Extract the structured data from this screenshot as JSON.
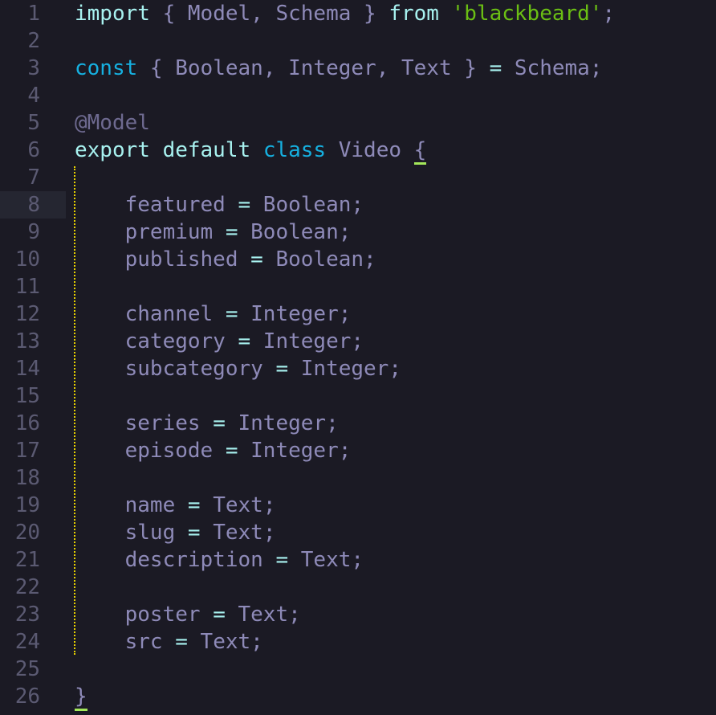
{
  "editor": {
    "active_line": 8,
    "lines": [
      {
        "n": "1",
        "tokens": [
          [
            "kw",
            "import"
          ],
          [
            "p",
            " { Model, Schema } "
          ],
          [
            "kw",
            "from"
          ],
          [
            "p",
            " "
          ],
          [
            "str",
            "'blackbeard'"
          ],
          [
            "p",
            ";"
          ]
        ]
      },
      {
        "n": "2",
        "tokens": []
      },
      {
        "n": "3",
        "tokens": [
          [
            "kw2",
            "const"
          ],
          [
            "p",
            " { Boolean, Integer, Text } "
          ],
          [
            "op",
            "="
          ],
          [
            "p",
            " Schema;"
          ]
        ]
      },
      {
        "n": "4",
        "tokens": []
      },
      {
        "n": "5",
        "tokens": [
          [
            "dec",
            "@Model"
          ]
        ]
      },
      {
        "n": "6",
        "tokens": [
          [
            "kw",
            "export default "
          ],
          [
            "kw2",
            "class"
          ],
          [
            "p",
            " Video "
          ],
          [
            "bm",
            "{"
          ]
        ]
      },
      {
        "n": "7",
        "tokens": []
      },
      {
        "n": "8",
        "tokens": [
          [
            "p",
            "    featured "
          ],
          [
            "op",
            "="
          ],
          [
            "p",
            " Boolean;"
          ]
        ]
      },
      {
        "n": "9",
        "tokens": [
          [
            "p",
            "    premium "
          ],
          [
            "op",
            "="
          ],
          [
            "p",
            " Boolean;"
          ]
        ]
      },
      {
        "n": "10",
        "tokens": [
          [
            "p",
            "    published "
          ],
          [
            "op",
            "="
          ],
          [
            "p",
            " Boolean;"
          ]
        ]
      },
      {
        "n": "11",
        "tokens": []
      },
      {
        "n": "12",
        "tokens": [
          [
            "p",
            "    channel "
          ],
          [
            "op",
            "="
          ],
          [
            "p",
            " Integer;"
          ]
        ]
      },
      {
        "n": "13",
        "tokens": [
          [
            "p",
            "    category "
          ],
          [
            "op",
            "="
          ],
          [
            "p",
            " Integer;"
          ]
        ]
      },
      {
        "n": "14",
        "tokens": [
          [
            "p",
            "    subcategory "
          ],
          [
            "op",
            "="
          ],
          [
            "p",
            " Integer;"
          ]
        ]
      },
      {
        "n": "15",
        "tokens": []
      },
      {
        "n": "16",
        "tokens": [
          [
            "p",
            "    series "
          ],
          [
            "op",
            "="
          ],
          [
            "p",
            " Integer;"
          ]
        ]
      },
      {
        "n": "17",
        "tokens": [
          [
            "p",
            "    episode "
          ],
          [
            "op",
            "="
          ],
          [
            "p",
            " Integer;"
          ]
        ]
      },
      {
        "n": "18",
        "tokens": []
      },
      {
        "n": "19",
        "tokens": [
          [
            "p",
            "    name "
          ],
          [
            "op",
            "="
          ],
          [
            "p",
            " Text;"
          ]
        ]
      },
      {
        "n": "20",
        "tokens": [
          [
            "p",
            "    slug "
          ],
          [
            "op",
            "="
          ],
          [
            "p",
            " Text;"
          ]
        ]
      },
      {
        "n": "21",
        "tokens": [
          [
            "p",
            "    description "
          ],
          [
            "op",
            "="
          ],
          [
            "p",
            " Text;"
          ]
        ]
      },
      {
        "n": "22",
        "tokens": []
      },
      {
        "n": "23",
        "tokens": [
          [
            "p",
            "    poster "
          ],
          [
            "op",
            "="
          ],
          [
            "p",
            " Text;"
          ]
        ]
      },
      {
        "n": "24",
        "tokens": [
          [
            "p",
            "    src "
          ],
          [
            "op",
            "="
          ],
          [
            "p",
            " Text;"
          ]
        ]
      },
      {
        "n": "25",
        "tokens": []
      },
      {
        "n": "26",
        "tokens": [
          [
            "bm",
            "}"
          ]
        ]
      }
    ]
  },
  "colors": {
    "background": "#1b1a24",
    "keyword": "#a8f2f0",
    "storage": "#16b0e0",
    "string": "#6bbf14",
    "text": "#8e8ab8",
    "bracket_match": "#a4e85a",
    "indent_guide": "#e8d200"
  }
}
